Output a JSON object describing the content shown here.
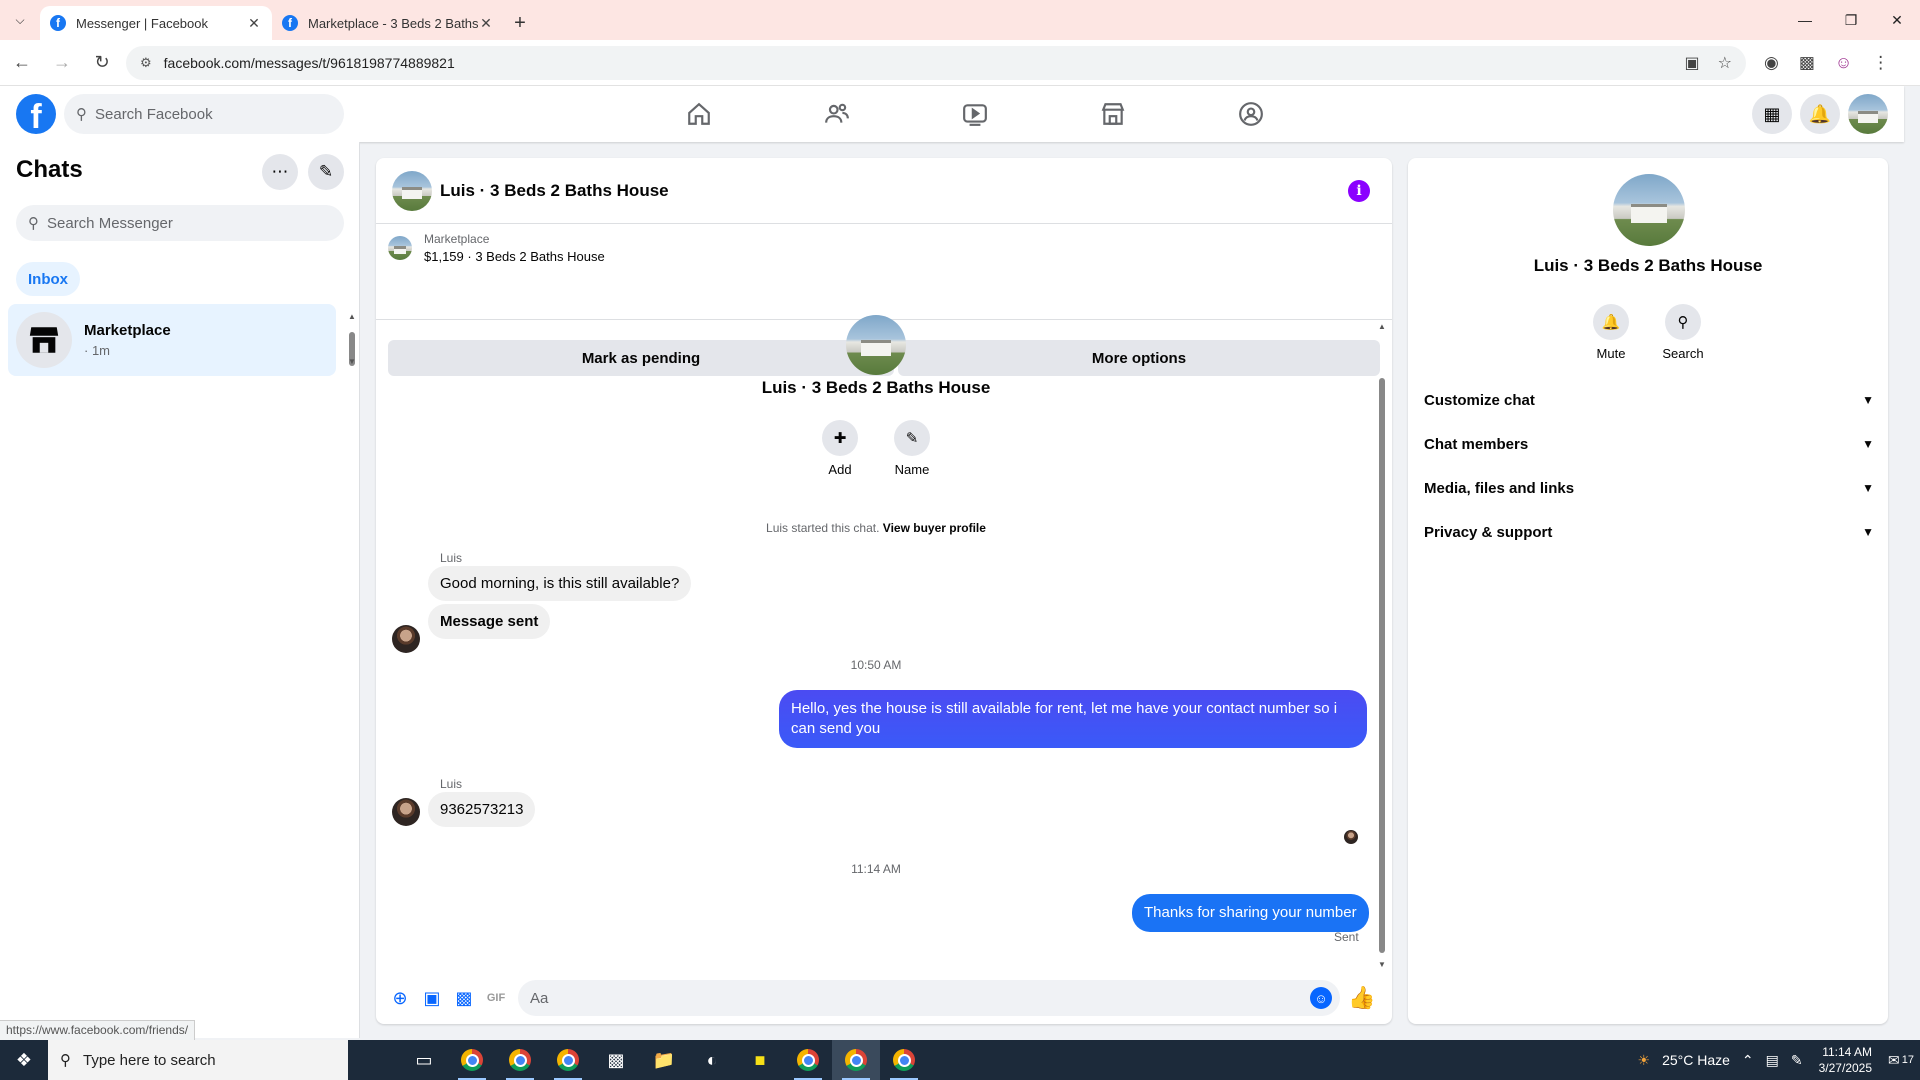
{
  "browser": {
    "tabs": [
      {
        "title": "Messenger | Facebook",
        "active": true
      },
      {
        "title": "Marketplace - 3 Beds 2 Baths H",
        "active": false
      }
    ],
    "url": "facebook.com/messages/t/9618198774889821",
    "status_link": "https://www.facebook.com/friends/"
  },
  "fb_nav": {
    "search_placeholder": "Search Facebook"
  },
  "sidebar": {
    "title": "Chats",
    "search_placeholder": "Search Messenger",
    "filter": "Inbox",
    "chats": [
      {
        "name": "Marketplace",
        "time": "· 1m"
      }
    ]
  },
  "chat": {
    "title": "Luis · 3 Beds 2 Baths House",
    "listing_source": "Marketplace",
    "listing_price": "$1,159 · 3 Beds 2 Baths House",
    "mark_pending_label": "Mark as pending",
    "more_options_label": "More options",
    "intro_name": "Luis · 3 Beds 2 Baths House",
    "intro_add": "Add",
    "intro_name_btn": "Name",
    "started_text": "Luis started this chat.",
    "buyer_profile_link": "View buyer profile",
    "messages": [
      {
        "sender": "Luis",
        "text": "Good morning, is this still available?"
      },
      {
        "text": "Message sent"
      },
      {
        "timestamp": "10:50 AM"
      },
      {
        "outgoing": true,
        "text": "Hello, yes the house is still available for rent, let me have your contact number so i can send you"
      },
      {
        "sender": "Luis",
        "text": "9362573213"
      },
      {
        "timestamp": "11:14 AM"
      },
      {
        "outgoing": true,
        "text": "Thanks for sharing your number"
      }
    ],
    "sent_status": "Sent",
    "composer_placeholder": "Aa"
  },
  "info_panel": {
    "name": "Luis · 3 Beds 2 Baths House",
    "mute_label": "Mute",
    "search_label": "Search",
    "sections": [
      "Customize chat",
      "Chat members",
      "Media, files and links",
      "Privacy & support"
    ]
  },
  "taskbar": {
    "search_placeholder": "Type here to search",
    "weather": "25°C Haze",
    "time": "11:14 AM",
    "date": "3/27/2025",
    "notifications": "17"
  },
  "colors": {
    "fb_blue": "#1877f2",
    "messenger_blue": "#0866ff",
    "outgoing_bubble": "#3a5af8",
    "info_purple": "#8b00ff"
  }
}
